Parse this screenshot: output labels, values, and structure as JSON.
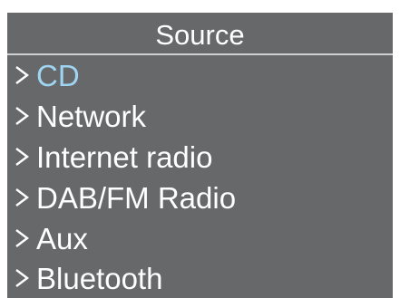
{
  "header": {
    "title": "Source"
  },
  "menu": {
    "selected_index": 0,
    "items": [
      {
        "label": "CD",
        "icon": "chevron-right-icon"
      },
      {
        "label": "Network",
        "icon": "chevron-right-icon"
      },
      {
        "label": "Internet radio",
        "icon": "chevron-right-icon"
      },
      {
        "label": "DAB/FM Radio",
        "icon": "chevron-right-icon"
      },
      {
        "label": "Aux",
        "icon": "chevron-right-icon"
      },
      {
        "label": "Bluetooth",
        "icon": "chevron-right-icon"
      }
    ]
  },
  "colors": {
    "panel": "#67686a",
    "text": "#ffffff",
    "selected_text": "#9fd5f3"
  }
}
